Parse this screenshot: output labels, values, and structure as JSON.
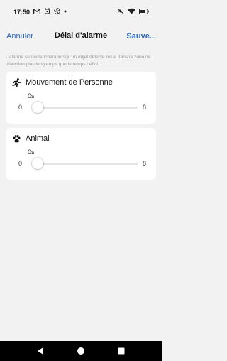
{
  "status_bar": {
    "time": "17:50",
    "left_icons": [
      "gmail-icon",
      "notification-icon",
      "pinwheel-icon",
      "dot-icon"
    ],
    "right_icons": [
      "mute-icon",
      "wifi-icon",
      "battery-icon"
    ]
  },
  "nav": {
    "cancel_label": "Annuler",
    "title": "Délai d'alarme",
    "save_label": "Sauve..."
  },
  "info_text": "L'alarme se déclenchera lorsqu'un objet détecté reste dans la zone de détection plus longtemps que le temps défini.",
  "cards": [
    {
      "icon": "running-person-icon",
      "title": "Mouvement de Personne",
      "value_label": "0s",
      "slider": {
        "min_label": "0",
        "max_label": "8",
        "min": 0,
        "max": 8,
        "value": 0
      }
    },
    {
      "icon": "paw-icon",
      "title": "Animal",
      "value_label": "0s",
      "slider": {
        "min_label": "0",
        "max_label": "8",
        "min": 0,
        "max": 8,
        "value": 0
      }
    }
  ],
  "colors": {
    "accent": "#2f67c7",
    "background": "#f2f2f2",
    "card": "#ffffff",
    "muted_text": "#9a9a9a"
  },
  "system_nav": [
    "back-icon",
    "home-icon",
    "recents-icon"
  ]
}
